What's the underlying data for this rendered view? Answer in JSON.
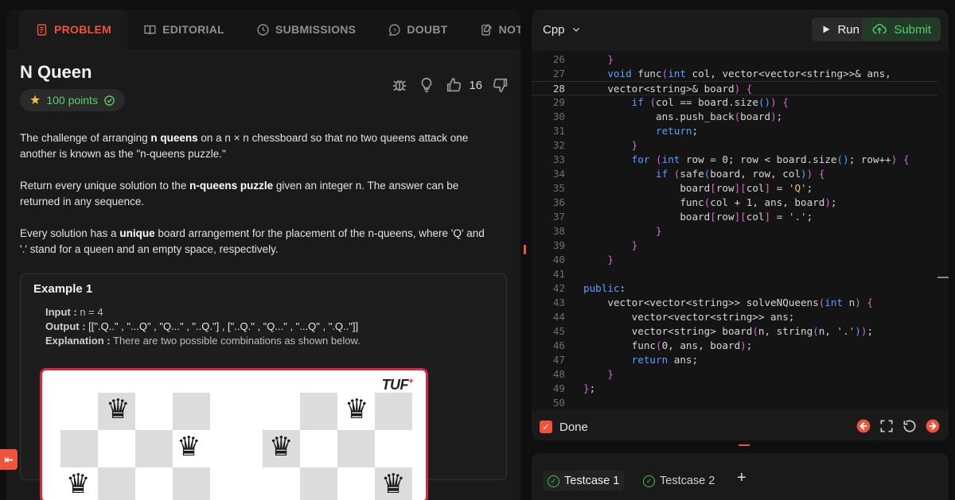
{
  "tabs": [
    {
      "label": "PROBLEM",
      "icon": "problem-icon",
      "active": true
    },
    {
      "label": "EDITORIAL",
      "icon": "book-icon",
      "active": false
    },
    {
      "label": "SUBMISSIONS",
      "icon": "clock-icon",
      "active": false
    },
    {
      "label": "DOUBT",
      "icon": "chat-icon",
      "active": false
    },
    {
      "label": "NOTES",
      "icon": "notes-icon",
      "active": false
    }
  ],
  "problem": {
    "title": "N Queen",
    "points": "100 points",
    "likes": "16",
    "para1_pre": "The challenge of arranging ",
    "para1_bold": "n queens",
    "para1_post": " on a n × n chessboard so that no two queens attack one another is known as the \"n-queens puzzle.\"",
    "para2_pre": "Return every unique solution to the ",
    "para2_bold": "n-queens puzzle",
    "para2_post": " given an integer n. The answer can be returned in any sequence.",
    "para3_pre": "Every solution has a ",
    "para3_bold": "unique",
    "para3_post": " board arrangement for the placement of the n-queens, where 'Q' and '.' stand for a queen and an empty space, respectively."
  },
  "example": {
    "title": "Example 1",
    "input_label": "Input :",
    "input_value": " n = 4",
    "output_label": "Output :",
    "output_value": " [[\".Q..\" , \"...Q\" , \"Q...\" , \"..Q.\"] , [\"..Q.\" , \"Q...\" , \"...Q\" , \".Q..\"]]",
    "explanation_label": "Explanation :",
    "explanation_value": " There are two possible combinations as shown below.",
    "logo": "TUF",
    "logo_plus": "+"
  },
  "editor": {
    "language": "Cpp",
    "run_label": "Run",
    "submit_label": "Submit",
    "done_label": "Done",
    "current_line": 28,
    "lines": [
      {
        "n": "26",
        "code": "    }"
      },
      {
        "n": "27",
        "code": "    void func(int col, vector<vector<string>>& ans,"
      },
      {
        "n": "28",
        "code": "    vector<string>& board) {"
      },
      {
        "n": "29",
        "code": "        if (col == board.size()) {"
      },
      {
        "n": "30",
        "code": "            ans.push_back(board);"
      },
      {
        "n": "31",
        "code": "            return;"
      },
      {
        "n": "32",
        "code": "        }"
      },
      {
        "n": "33",
        "code": "        for (int row = 0; row < board.size(); row++) {"
      },
      {
        "n": "34",
        "code": "            if (safe(board, row, col)) {"
      },
      {
        "n": "35",
        "code": "                board[row][col] = 'Q';"
      },
      {
        "n": "36",
        "code": "                func(col + 1, ans, board);"
      },
      {
        "n": "37",
        "code": "                board[row][col] = '.';"
      },
      {
        "n": "38",
        "code": "            }"
      },
      {
        "n": "39",
        "code": "        }"
      },
      {
        "n": "40",
        "code": "    }"
      },
      {
        "n": "41",
        "code": ""
      },
      {
        "n": "42",
        "code": "public:"
      },
      {
        "n": "43",
        "code": "    vector<vector<string>> solveNQueens(int n) {"
      },
      {
        "n": "44",
        "code": "        vector<vector<string>> ans;"
      },
      {
        "n": "45",
        "code": "        vector<string> board(n, string(n, '.'));"
      },
      {
        "n": "46",
        "code": "        func(0, ans, board);"
      },
      {
        "n": "47",
        "code": "        return ans;"
      },
      {
        "n": "48",
        "code": "    }"
      },
      {
        "n": "49",
        "code": "};"
      },
      {
        "n": "50",
        "code": ""
      }
    ]
  },
  "testcases": [
    {
      "label": "Testcase 1",
      "active": true
    },
    {
      "label": "Testcase 2",
      "active": false
    }
  ],
  "add_testcase_label": "+",
  "colors": {
    "accent": "#f0533c",
    "success": "#4ecf6a",
    "panel": "#1a1a1a"
  }
}
